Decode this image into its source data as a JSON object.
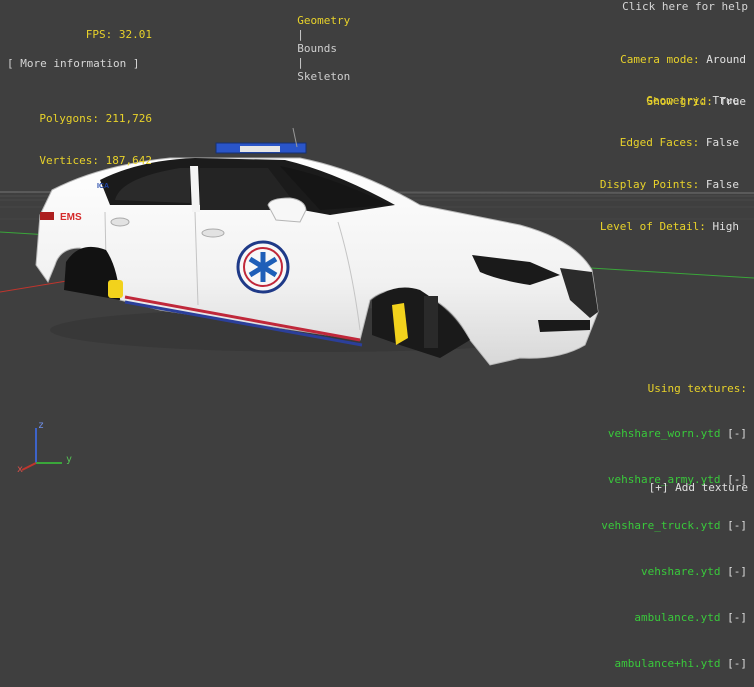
{
  "tabs": {
    "geometry": "Geometry",
    "bounds": "Bounds",
    "skeleton": "Skeleton",
    "separator": "|"
  },
  "stats": {
    "fps_label": "FPS:",
    "fps_value": "32.01",
    "polygons_label": "Polygons:",
    "polygons_value": "211,726",
    "vertices_label": "Vertices:",
    "vertices_value": "187,642"
  },
  "more_info": "[ More information ]",
  "help": "Click here for help",
  "view": {
    "camera_label": "Camera mode:",
    "camera_value": "Around",
    "grid_label": "Show grid:",
    "grid_value": "True"
  },
  "render": {
    "geometry_label": "Geometry:",
    "geometry_value": "True",
    "edged_label": "Edged Faces:",
    "edged_value": "False",
    "points_label": "Display Points:",
    "points_value": "False",
    "lod_label": "Level of Detail:",
    "lod_value": "High"
  },
  "textures": {
    "header": "Using textures:",
    "remove_label": "[-]",
    "items": [
      {
        "name": "vehshare_worn.ytd"
      },
      {
        "name": "vehshare_army.ytd"
      },
      {
        "name": "vehshare_truck.ytd"
      },
      {
        "name": "vehshare.ytd"
      },
      {
        "name": "ambulance.ytd"
      },
      {
        "name": "ambulance+hi.ytd"
      }
    ],
    "add_label": "[+] Add texture"
  },
  "decals": {
    "ems": "EMS",
    "side_code": "ICA"
  },
  "axes": {
    "x": "x",
    "y": "y",
    "z": "z"
  },
  "colors": {
    "background": "#3f3f3f",
    "hud_yellow": "#e8d22a",
    "hud_green": "#39c93b",
    "hud_white": "#e0e0e0",
    "caliper_yellow": "#f2d21c",
    "stripe_red": "#c0283a",
    "stripe_blue": "#2b3f9a",
    "lightbar_blue": "#2a55c8"
  }
}
